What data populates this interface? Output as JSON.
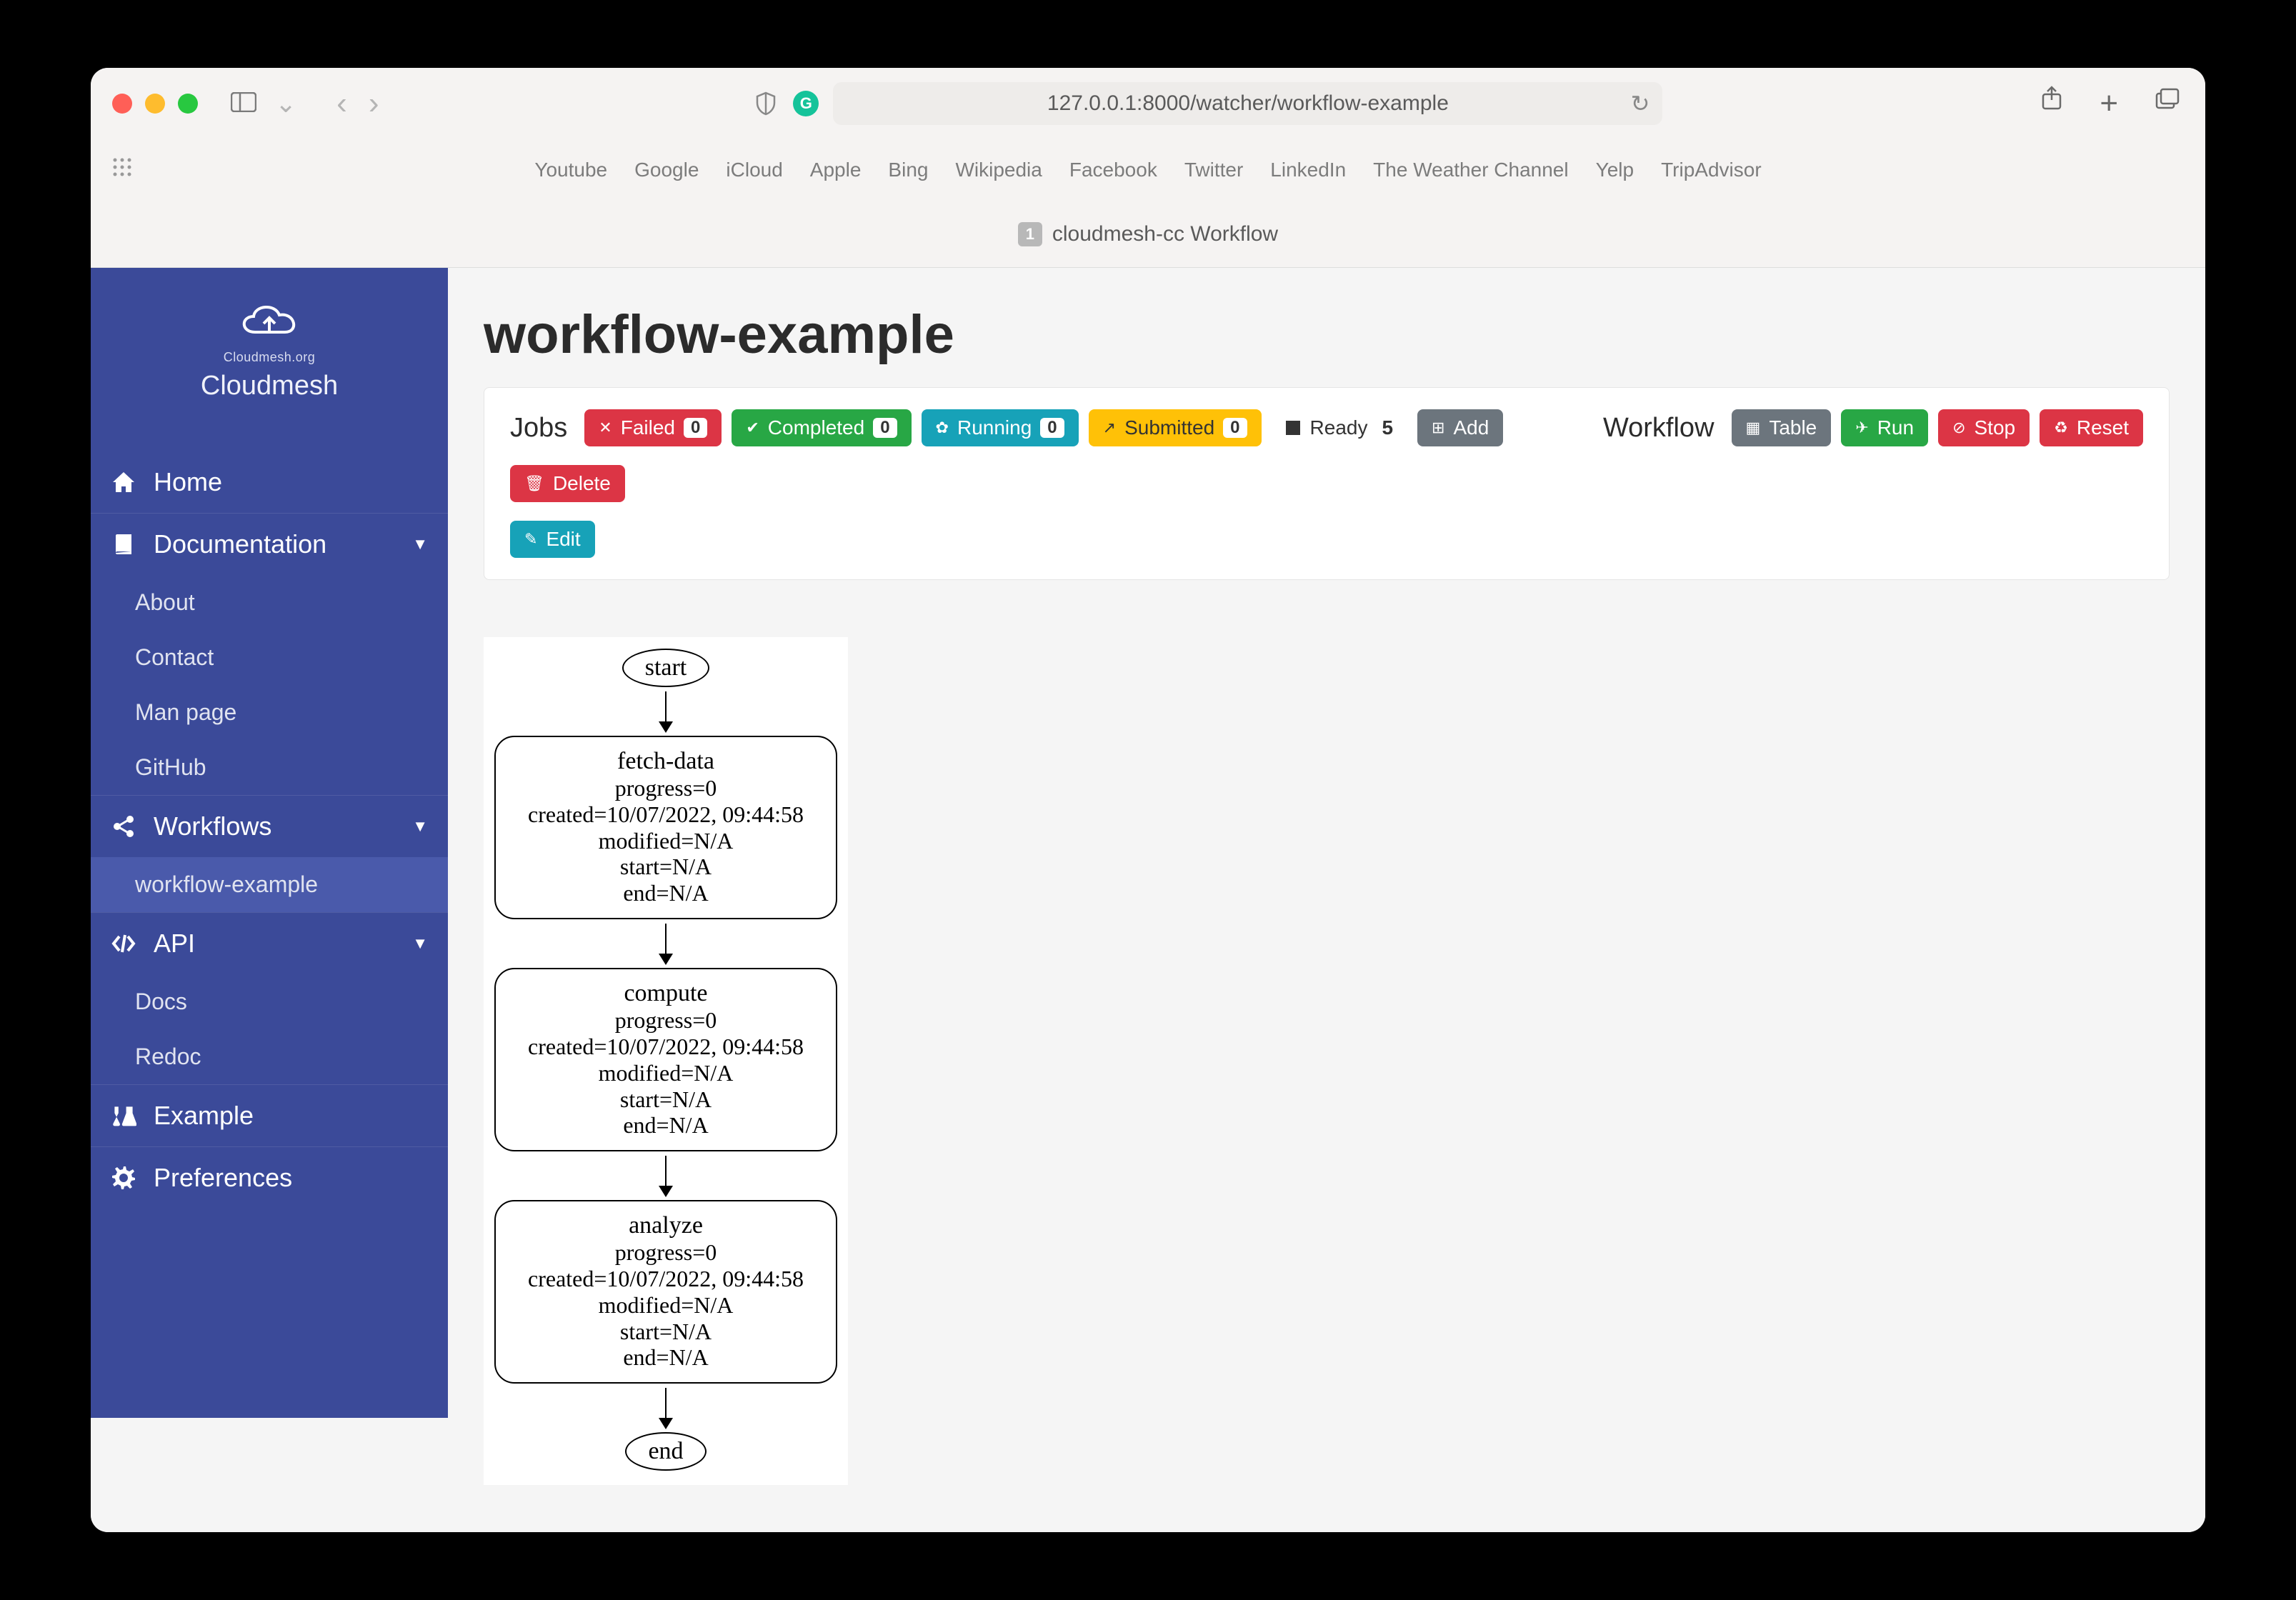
{
  "browser": {
    "url": "127.0.0.1:8000/watcher/workflow-example",
    "bookmarks": [
      "Youtube",
      "Google",
      "iCloud",
      "Apple",
      "Bing",
      "Wikipedia",
      "Facebook",
      "Twitter",
      "LinkedIn",
      "The Weather Channel",
      "Yelp",
      "TripAdvisor"
    ],
    "tab_title": "cloudmesh-cc Workflow",
    "tab_badge": "1"
  },
  "sidebar": {
    "brand_sub": "Cloudmesh.org",
    "brand_title": "Cloudmesh",
    "items": {
      "home": "Home",
      "documentation": "Documentation",
      "workflows": "Workflows",
      "api": "API",
      "example": "Example",
      "preferences": "Preferences"
    },
    "doc_sub": [
      "About",
      "Contact",
      "Man page",
      "GitHub"
    ],
    "workflows_sub": [
      "workflow-example"
    ],
    "api_sub": [
      "Docs",
      "Redoc"
    ]
  },
  "main": {
    "title": "workflow-example",
    "jobs_label": "Jobs",
    "workflow_label": "Workflow",
    "buttons": {
      "failed": "Failed",
      "completed": "Completed",
      "running": "Running",
      "submitted": "Submitted",
      "ready": "Ready",
      "add": "Add",
      "table": "Table",
      "run": "Run",
      "stop": "Stop",
      "reset": "Reset",
      "delete": "Delete",
      "edit": "Edit"
    },
    "counts": {
      "failed": "0",
      "completed": "0",
      "running": "0",
      "submitted": "0",
      "ready": "5"
    }
  },
  "diagram": {
    "start": "start",
    "end": "end",
    "nodes": [
      {
        "name": "fetch-data",
        "lines": [
          "progress=0",
          "created=10/07/2022, 09:44:58",
          "modified=N/A",
          "start=N/A",
          "end=N/A"
        ]
      },
      {
        "name": "compute",
        "lines": [
          "progress=0",
          "created=10/07/2022, 09:44:58",
          "modified=N/A",
          "start=N/A",
          "end=N/A"
        ]
      },
      {
        "name": "analyze",
        "lines": [
          "progress=0",
          "created=10/07/2022, 09:44:58",
          "modified=N/A",
          "start=N/A",
          "end=N/A"
        ]
      }
    ]
  },
  "colors": {
    "sidebar": "#3b4a99",
    "red": "#dc3545",
    "green": "#28a745",
    "teal": "#17a2b8",
    "yellow": "#ffc107",
    "gray": "#6c757d"
  }
}
